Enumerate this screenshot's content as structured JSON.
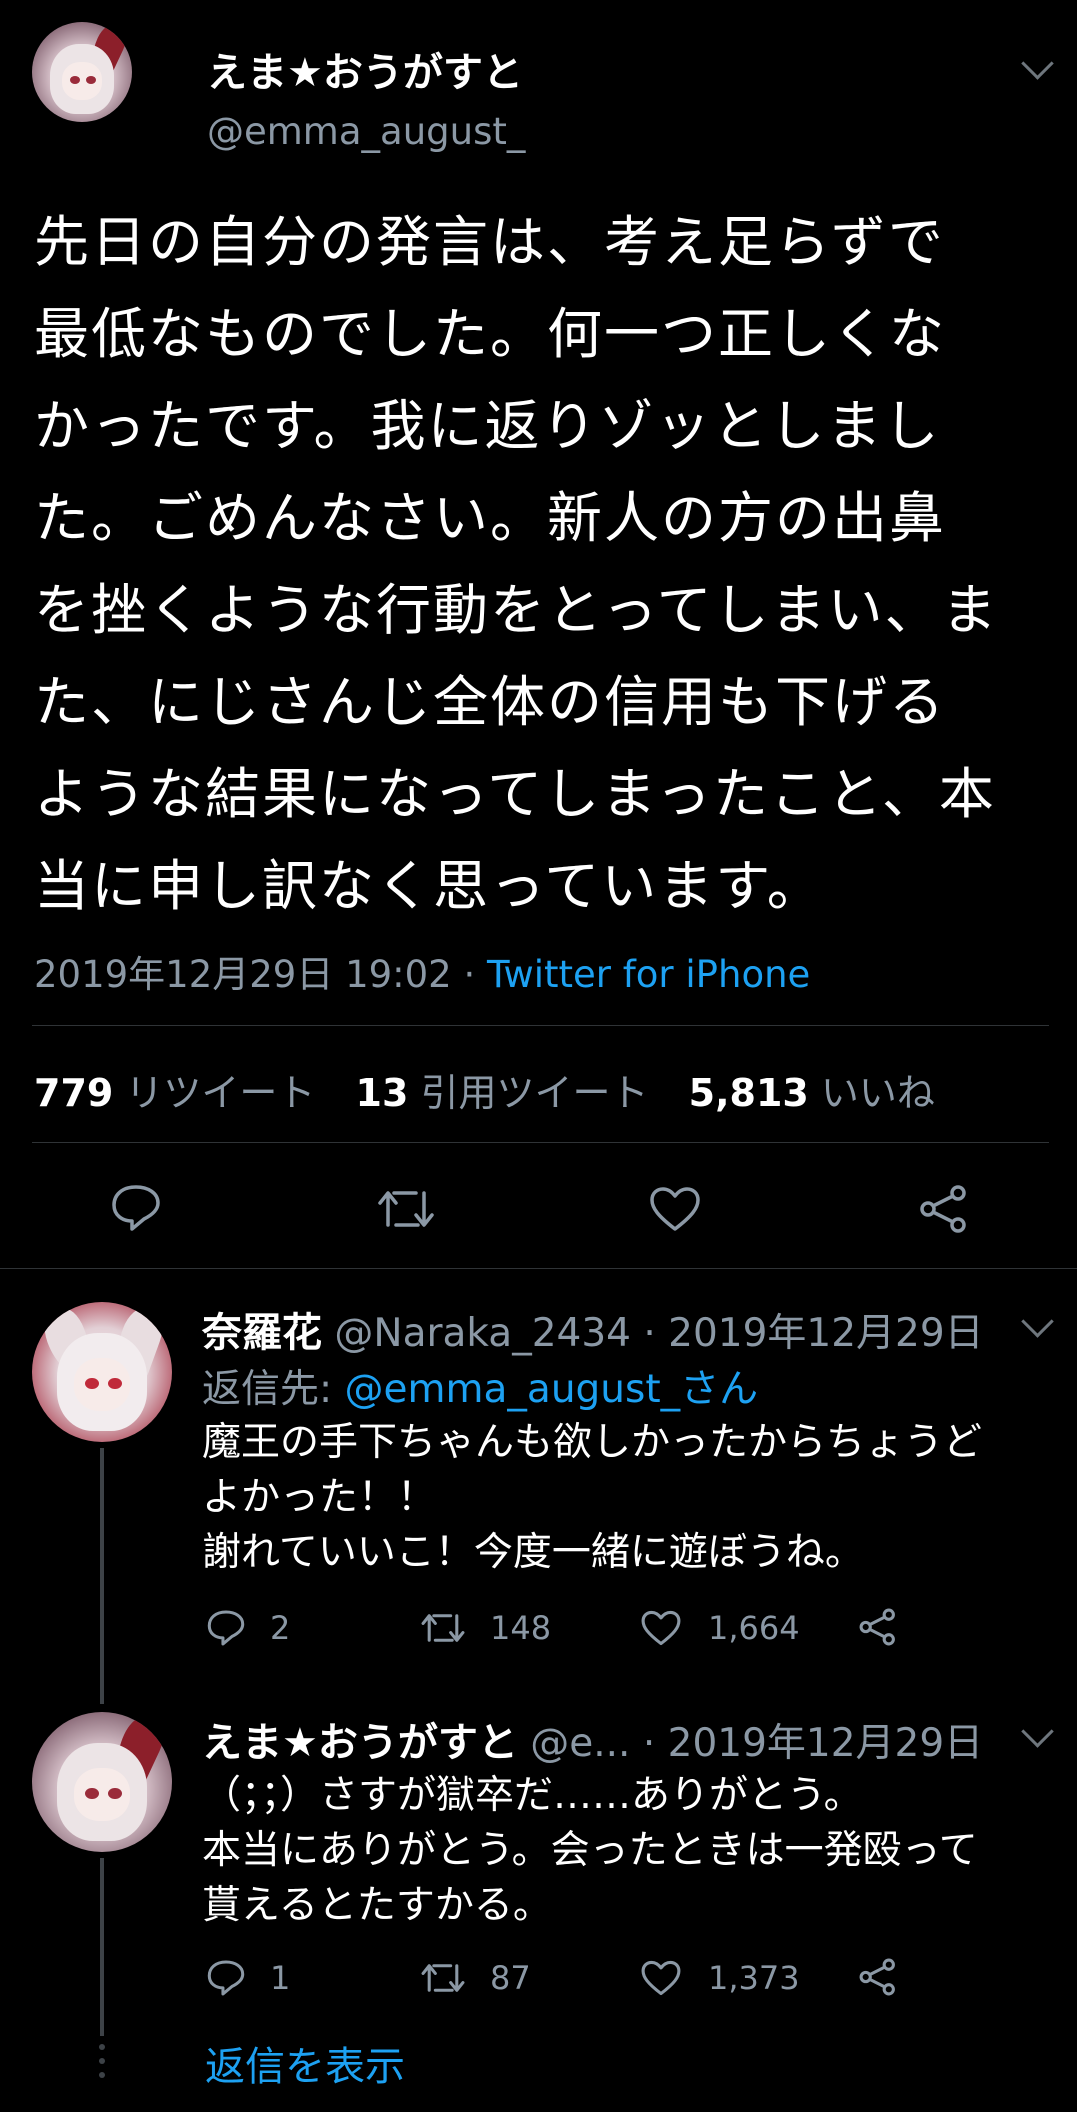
{
  "main_tweet": {
    "author_name": "えま★おうがすと",
    "author_handle": "@emma_august_",
    "text_lines": [
      "先日の自分の発言は、考え足らずで",
      "最低なものでした。何一つ正しくな",
      "かったです。我に返りゾッとしまし",
      "た。ごめんなさい。新人の方の出鼻",
      "を挫くような行動をとってしまい、ま",
      "た、にじさんじ全体の信用も下げる",
      "ような結果になってしまったこと、本",
      "当に申し訳なく思っています。"
    ],
    "timestamp": "2019年12月29日 19:02 · ",
    "source": "Twitter for iPhone",
    "retweets_count": "779",
    "retweets_label": "リツイート",
    "quotes_count": "13",
    "quotes_label": "引用ツイート",
    "likes_count": "5,813",
    "likes_label": "いいね"
  },
  "replies": [
    {
      "author_name": "奈羅花",
      "header_meta": "@Naraka_2434 · 2019年12月29日",
      "reply_to_prefix": "返信先: ",
      "reply_to_handle": "@emma_august_さん",
      "text_lines": [
        "魔王の手下ちゃんも欲しかったからちょうど",
        "よかった！！",
        "謝れていいこ！今度一緒に遊ぼうね。"
      ],
      "reply_count": "2",
      "retweet_count": "148",
      "like_count": "1,664"
    },
    {
      "author_name": "えま★おうがすと",
      "header_meta": "@e... · 2019年12月29日",
      "text_lines": [
        "（；；）さすが獄卒だ……ありがとう。",
        "本当にありがとう。会ったときは一発殴って",
        "貰えるとたすかる。"
      ],
      "reply_count": "1",
      "retweet_count": "87",
      "like_count": "1,373"
    }
  ],
  "show_replies_label": "返信を表示",
  "colors": {
    "background": "#000000",
    "accent": "#1da1f2",
    "secondary_text": "#8b98a5",
    "divider": "#2f3336"
  },
  "icons": [
    "chevron-down-icon",
    "reply-icon",
    "retweet-icon",
    "like-icon",
    "share-icon"
  ]
}
